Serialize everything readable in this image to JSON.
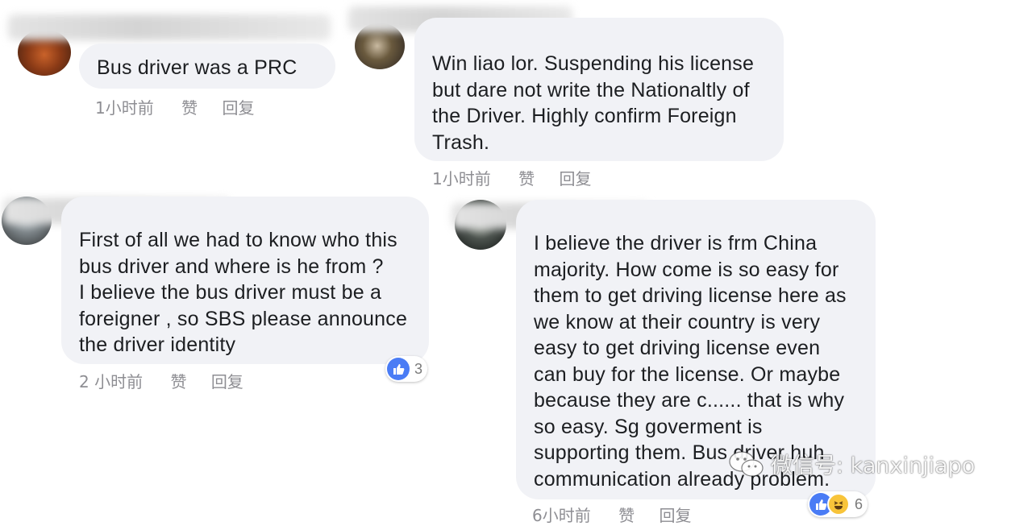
{
  "comments": [
    {
      "text_lines": [
        "Bus driver was a PRC"
      ],
      "time": "1小时前",
      "like_label": "赞",
      "reply_label": "回复"
    },
    {
      "text_lines": [
        "Win liao lor. Suspending his license",
        "but dare not write the Nationaltly of",
        "the Driver. Highly confirm Foreign",
        "Trash."
      ],
      "time": "1小时前",
      "like_label": "赞",
      "reply_label": "回复"
    },
    {
      "text_lines": [
        "First of all we had to know who this",
        "bus driver and where is he from ?",
        "I believe the bus driver must be a",
        "foreigner , so SBS please announce",
        "the driver identity"
      ],
      "time": "2 小时前",
      "like_label": "赞",
      "reply_label": "回复",
      "reaction_count": "3"
    },
    {
      "text_lines": [
        "I believe the driver is frm China",
        "majority. How come is so easy for",
        "them to get driving license here as",
        "we know at their country is very",
        "easy to get driving license even",
        "can buy for the license. Or maybe",
        "because they are c...... that is why",
        "so easy. Sg goverment is",
        "supporting them. Bus driver huh",
        "communication already problem."
      ],
      "time": "6小时前",
      "like_label": "赞",
      "reply_label": "回复",
      "reaction_count": "6"
    }
  ],
  "watermark": {
    "text": "微信号: kanxinjiapo"
  },
  "icons": {
    "like": "thumbs-up-icon",
    "haha": "haha-emoji-icon",
    "wechat": "wechat-logo-icon"
  },
  "colors": {
    "bubble": "#f1f2f6",
    "meta_text": "#8e8e93",
    "like_blue": "#4a7cf5",
    "haha_yellow": "#f8c43a"
  }
}
